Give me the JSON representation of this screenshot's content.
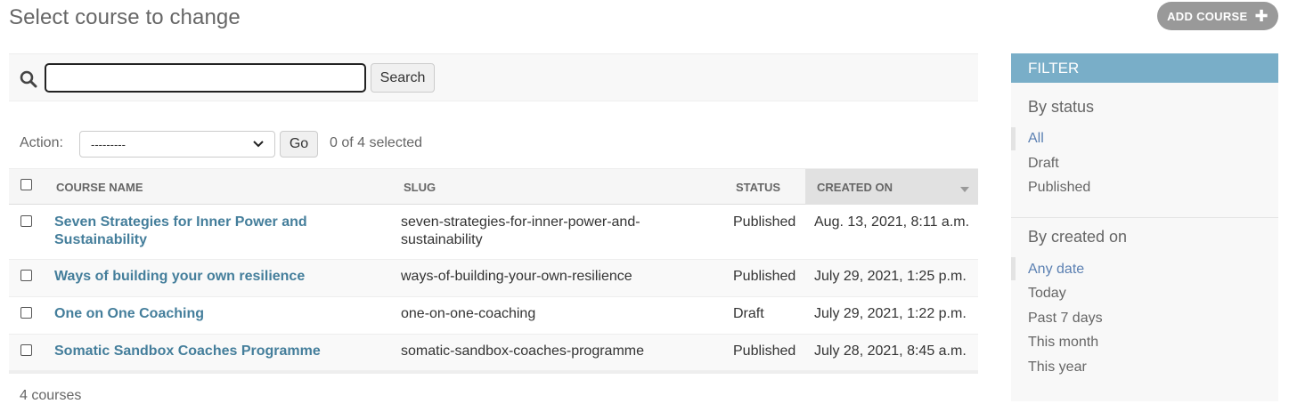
{
  "header": {
    "title": "Select course to change",
    "add_button_label": "ADD COURSE",
    "add_icon": "plus-icon"
  },
  "search": {
    "value": "",
    "button_label": "Search",
    "icon": "search-icon"
  },
  "actions": {
    "label": "Action:",
    "selected_value": "---------",
    "go_label": "Go",
    "selection_status": "0 of 4 selected"
  },
  "table": {
    "columns": [
      "COURSE NAME",
      "SLUG",
      "STATUS",
      "CREATED ON"
    ],
    "rows": [
      {
        "name_line1": "Seven Strategies for Inner Power and",
        "name_line2": "Sustainability",
        "slug_line1": "seven-strategies-for-inner-power-and-",
        "slug_line2": "sustainability",
        "status": "Published",
        "created_on": "Aug. 13, 2021, 8:11 a.m."
      },
      {
        "name_line1": "Ways of building your own resilience",
        "slug_line1": "ways-of-building-your-own-resilience",
        "status": "Published",
        "created_on": "July 29, 2021, 1:25 p.m."
      },
      {
        "name_line1": "One on One Coaching",
        "slug_line1": "one-on-one-coaching",
        "status": "Draft",
        "created_on": "July 29, 2021, 1:22 p.m."
      },
      {
        "name_line1": "Somatic Sandbox Coaches Programme",
        "slug_line1": "somatic-sandbox-coaches-programme",
        "status": "Published",
        "created_on": "July 28, 2021, 8:45 a.m."
      }
    ],
    "result_count": "4 courses"
  },
  "filter": {
    "title": "FILTER",
    "groups": [
      {
        "title": "By status",
        "options": [
          "All",
          "Draft",
          "Published"
        ],
        "selected": "All"
      },
      {
        "title": "By created on",
        "options": [
          "Any date",
          "Today",
          "Past 7 days",
          "This month",
          "This year"
        ],
        "selected": "Any date"
      }
    ]
  },
  "colors": {
    "link": "#447e9b",
    "filter_header": "#79aec8",
    "add_button": "#999999",
    "selected_filter": "#5b80b2"
  }
}
